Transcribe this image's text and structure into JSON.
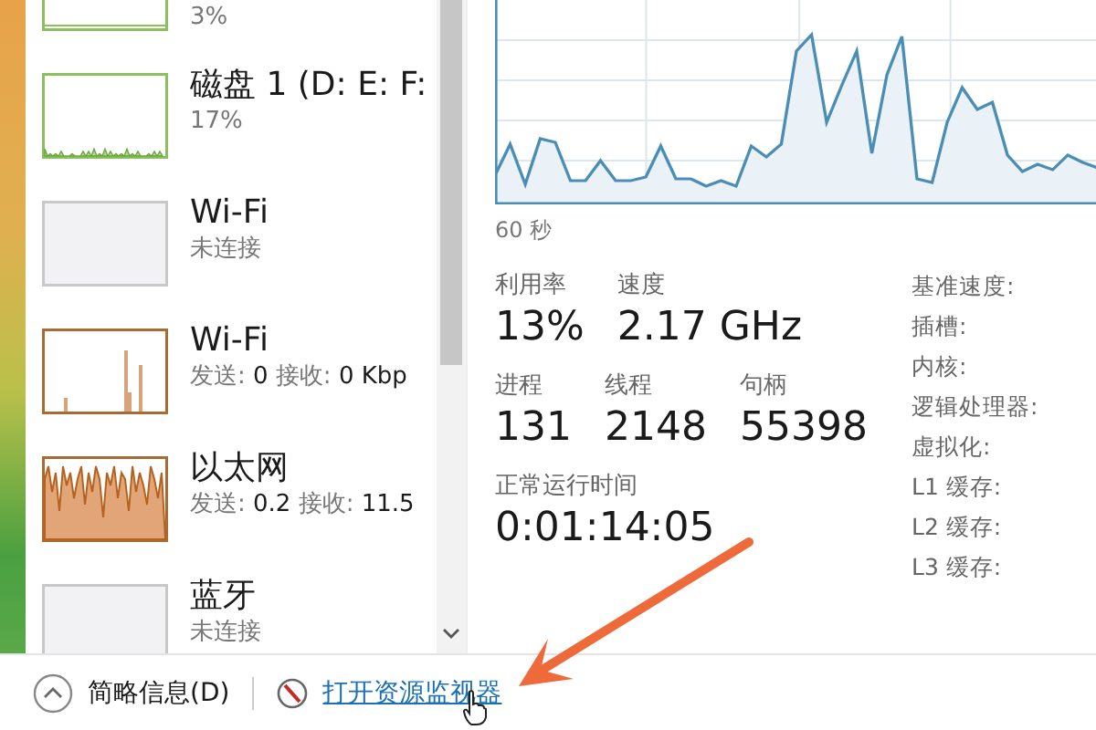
{
  "sidebar": {
    "items": [
      {
        "kind": "disk-flat",
        "subtitle": "3%"
      },
      {
        "kind": "disk",
        "title": "磁盘 1 (D: E: F:",
        "subtitle": "17%"
      },
      {
        "kind": "idle",
        "title": "Wi-Fi",
        "subtitle": "未连接"
      },
      {
        "kind": "network",
        "title": "Wi-Fi",
        "subtitle": "发送: **0** 接收: **0 Kbp**"
      },
      {
        "kind": "network-busy",
        "title": "以太网",
        "subtitle": "发送: **0.2** 接收: **11.5**"
      },
      {
        "kind": "idle",
        "title": "蓝牙",
        "subtitle": "未连接"
      }
    ]
  },
  "graph": {
    "time_label": "60 秒"
  },
  "stats": [
    [
      {
        "label": "利用率",
        "value": "13%"
      },
      {
        "label": "速度",
        "value": "2.17 GHz"
      }
    ],
    [
      {
        "label": "进程",
        "value": "131"
      },
      {
        "label": "线程",
        "value": "2148"
      },
      {
        "label": "句柄",
        "value": "55398"
      }
    ],
    [
      {
        "label": "正常运行时间",
        "value": "0:01:14:05"
      }
    ]
  ],
  "details": [
    "基准速度:",
    "插槽:",
    "内核:",
    "逻辑处理器:",
    "虚拟化:",
    "L1 缓存:",
    "L2 缓存:",
    "L3 缓存:"
  ],
  "footer": {
    "summary_toggle": "简略信息(D)",
    "resource_monitor_link": "打开资源监视器"
  }
}
